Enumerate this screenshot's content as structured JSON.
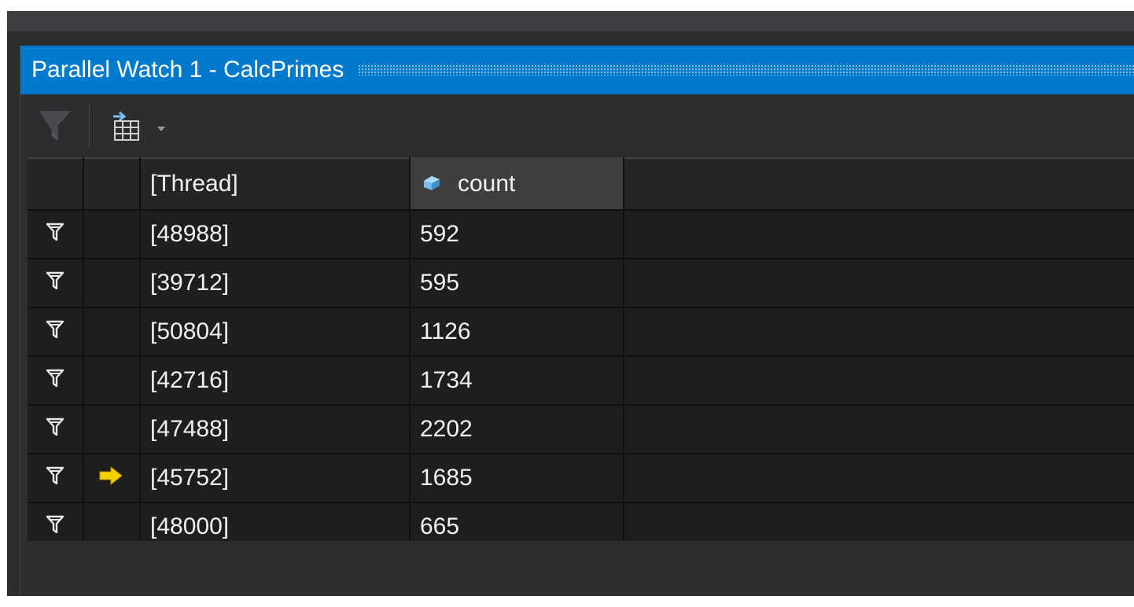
{
  "window": {
    "title": "Parallel Watch 1 - CalcPrimes"
  },
  "toolbar": {
    "icons": [
      "filter-icon",
      "add-watch-grid-icon",
      "dropdown-arrow-icon"
    ]
  },
  "table": {
    "columns": [
      "",
      "",
      "[Thread]",
      "count",
      ""
    ],
    "rows": [
      {
        "thread": "[48988]",
        "count": "592",
        "current": false
      },
      {
        "thread": "[39712]",
        "count": "595",
        "current": false
      },
      {
        "thread": "[50804]",
        "count": "1126",
        "current": false
      },
      {
        "thread": "[42716]",
        "count": "1734",
        "current": false
      },
      {
        "thread": "[47488]",
        "count": "2202",
        "current": false
      },
      {
        "thread": "[45752]",
        "count": "1685",
        "current": true
      },
      {
        "thread": "[48000]",
        "count": "665",
        "current": false
      }
    ]
  },
  "colors": {
    "title_bar": "#007acc",
    "background": "#2d2d30",
    "cell_background": "#1e1e1e",
    "current_thread_arrow": "#f5d000",
    "count_icon": "#75bef0"
  }
}
